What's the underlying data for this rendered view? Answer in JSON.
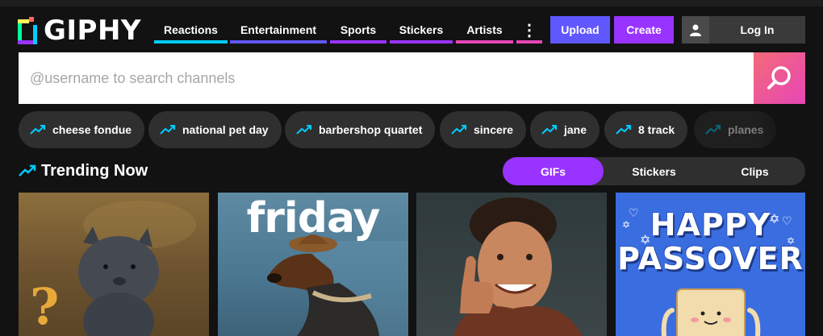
{
  "brand": {
    "name": "GIPHY"
  },
  "nav": {
    "items": [
      {
        "label": "Reactions",
        "color": "#00ccff"
      },
      {
        "label": "Entertainment",
        "color": "#6157ff"
      },
      {
        "label": "Sports",
        "color": "#9933ff"
      },
      {
        "label": "Stickers",
        "color": "#9933ff"
      },
      {
        "label": "Artists",
        "color": "#e646b6"
      }
    ],
    "more_icon": "more-vertical-icon",
    "more_label": "⋮"
  },
  "actions": {
    "upload_label": "Upload",
    "create_label": "Create",
    "login_label": "Log In",
    "login_icon": "user-icon"
  },
  "search": {
    "placeholder": "@username to search channels",
    "value": "",
    "button_icon": "search-icon"
  },
  "trending_searches": [
    {
      "label": "cheese fondue",
      "icon": "trending-up-icon"
    },
    {
      "label": "national pet day",
      "icon": "trending-up-icon"
    },
    {
      "label": "barbershop quartet",
      "icon": "trending-up-icon"
    },
    {
      "label": "sincere",
      "icon": "trending-up-icon"
    },
    {
      "label": "jane",
      "icon": "trending-up-icon"
    },
    {
      "label": "8 track",
      "icon": "trending-up-icon"
    },
    {
      "label": "planes",
      "icon": "trending-up-icon"
    }
  ],
  "trending_now": {
    "title": "Trending Now",
    "icon": "trending-up-icon",
    "tabs": [
      {
        "label": "GIFs",
        "active": true
      },
      {
        "label": "Stickers",
        "active": false
      },
      {
        "label": "Clips",
        "active": false
      }
    ],
    "tiles": [
      {
        "subject": "gray-cat-puppet"
      },
      {
        "subject": "dachshund-in-hat",
        "overlay_text": "friday"
      },
      {
        "subject": "man-thumbs-up"
      },
      {
        "subject": "passover-matzah",
        "overlay_text_line1": "HAPPY",
        "overlay_text_line2": "PASSOVER"
      }
    ]
  },
  "colors": {
    "background": "#121212",
    "pill_bg": "#2f2f2f",
    "upload": "#6157ff",
    "create": "#9933ff",
    "trend_icon": "#00ccff",
    "active_tab": "#9933ff"
  }
}
